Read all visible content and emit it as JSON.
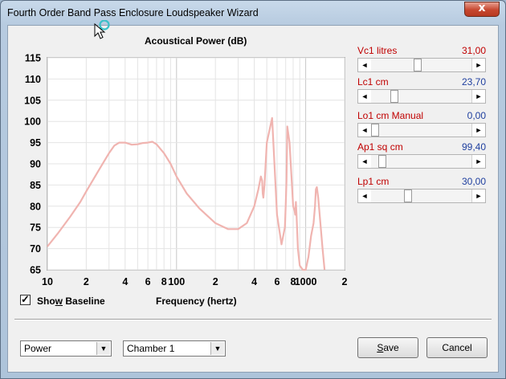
{
  "window": {
    "title": "Fourth Order Band Pass Enclosure Loudspeaker Wizard",
    "close_label": "x"
  },
  "chart_data": {
    "type": "line",
    "title": "Acoustical Power (dB)",
    "xlabel": "Frequency (hertz)",
    "ylabel": "",
    "xscale": "log",
    "xlim": [
      10,
      2000
    ],
    "ylim": [
      65,
      115
    ],
    "grid": true,
    "y_ticks": [
      "115",
      "110",
      "105",
      "100",
      "95",
      "90",
      "85",
      "80",
      "75",
      "70",
      "65"
    ],
    "y_tick_values": [
      115,
      110,
      105,
      100,
      95,
      90,
      85,
      80,
      75,
      70,
      65
    ],
    "x_ticks": [
      "10",
      "2",
      "4",
      "6",
      "8",
      "100",
      "2",
      "4",
      "6",
      "8",
      "1000",
      "2"
    ],
    "x_tick_values": [
      10,
      20,
      40,
      60,
      80,
      100,
      200,
      400,
      600,
      800,
      1000,
      2000
    ],
    "color": "#f0b4b0",
    "series": [
      {
        "x": [
          10,
          12,
          15,
          18,
          20,
          25,
          30,
          33,
          36,
          40,
          45,
          50,
          55,
          60,
          65,
          70,
          80,
          90,
          100,
          120,
          150,
          200,
          250,
          300,
          350,
          400,
          430,
          450,
          460,
          465,
          470,
          480,
          500,
          550,
          600,
          650,
          690,
          700,
          710,
          720,
          750,
          800,
          820,
          830,
          840,
          850,
          870,
          900,
          950,
          1000,
          1050,
          1100,
          1150,
          1180,
          1200,
          1220,
          1250,
          1300,
          1350,
          1400
        ],
        "y": [
          70.5,
          73.5,
          77.5,
          81,
          83.5,
          88.5,
          92.5,
          94.3,
          95,
          95,
          94.5,
          94.6,
          94.9,
          95,
          95.2,
          94.6,
          92.5,
          90,
          87,
          83,
          79.5,
          76,
          74.6,
          74.6,
          76,
          80,
          84,
          87,
          86,
          83,
          82,
          85,
          95,
          100.8,
          78,
          71,
          75,
          80,
          86,
          98.8,
          95,
          80,
          79,
          78,
          81,
          78,
          70,
          66,
          64.5,
          64,
          68,
          73,
          76,
          80,
          84,
          84.5,
          82,
          76,
          70,
          65
        ]
      }
    ]
  },
  "baseline": {
    "checked_glyph": "✓",
    "label_pre": "Sho",
    "label_key": "w",
    "label_post": " Baseline"
  },
  "sliders": [
    {
      "label": "Vc1  litres",
      "value": "31,00",
      "value_color": "red",
      "thumb": 0.46
    },
    {
      "label": "Lc1  cm",
      "value": "23,70",
      "value_color": "blue",
      "thumb": 0.21
    },
    {
      "label": "Lo1  cm  Manual",
      "value": "0,00",
      "value_color": "blue",
      "thumb": 0.0
    },
    {
      "label": "Ap1  sq cm",
      "value": "99,40",
      "value_color": "blue",
      "thumb": 0.08
    },
    {
      "label": "Lp1  cm",
      "value": "30,00",
      "value_color": "blue",
      "thumb": 0.35
    }
  ],
  "controls": {
    "mode_select": "Power",
    "chamber_select": "Chamber 1",
    "save_pre": "",
    "save_key": "S",
    "save_post": "ave",
    "cancel_label": "Cancel",
    "arrow_glyph": "▼",
    "left_arrow": "◄",
    "right_arrow": "►"
  }
}
